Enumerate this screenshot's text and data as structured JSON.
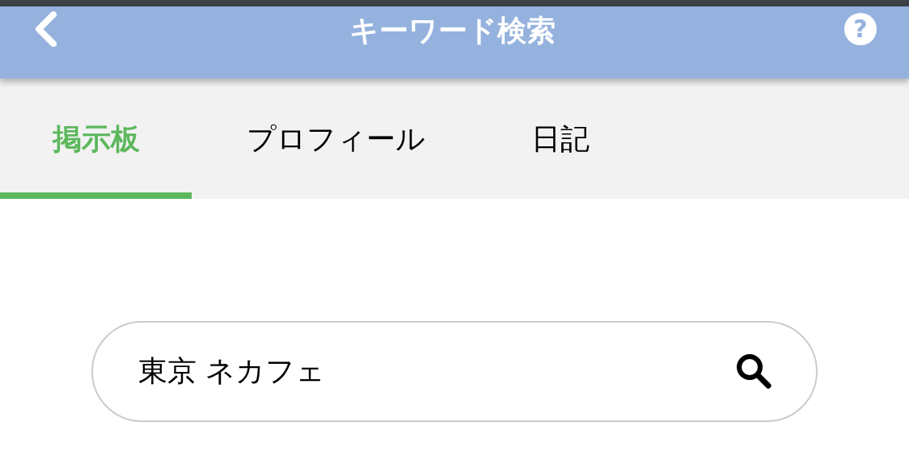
{
  "header": {
    "title": "キーワード検索",
    "help_label": "?"
  },
  "tabs": [
    {
      "label": "掲示板",
      "selected": true
    },
    {
      "label": "プロフィール",
      "selected": false
    },
    {
      "label": "日記",
      "selected": false
    }
  ],
  "search": {
    "value": "東京 ネカフェ"
  }
}
